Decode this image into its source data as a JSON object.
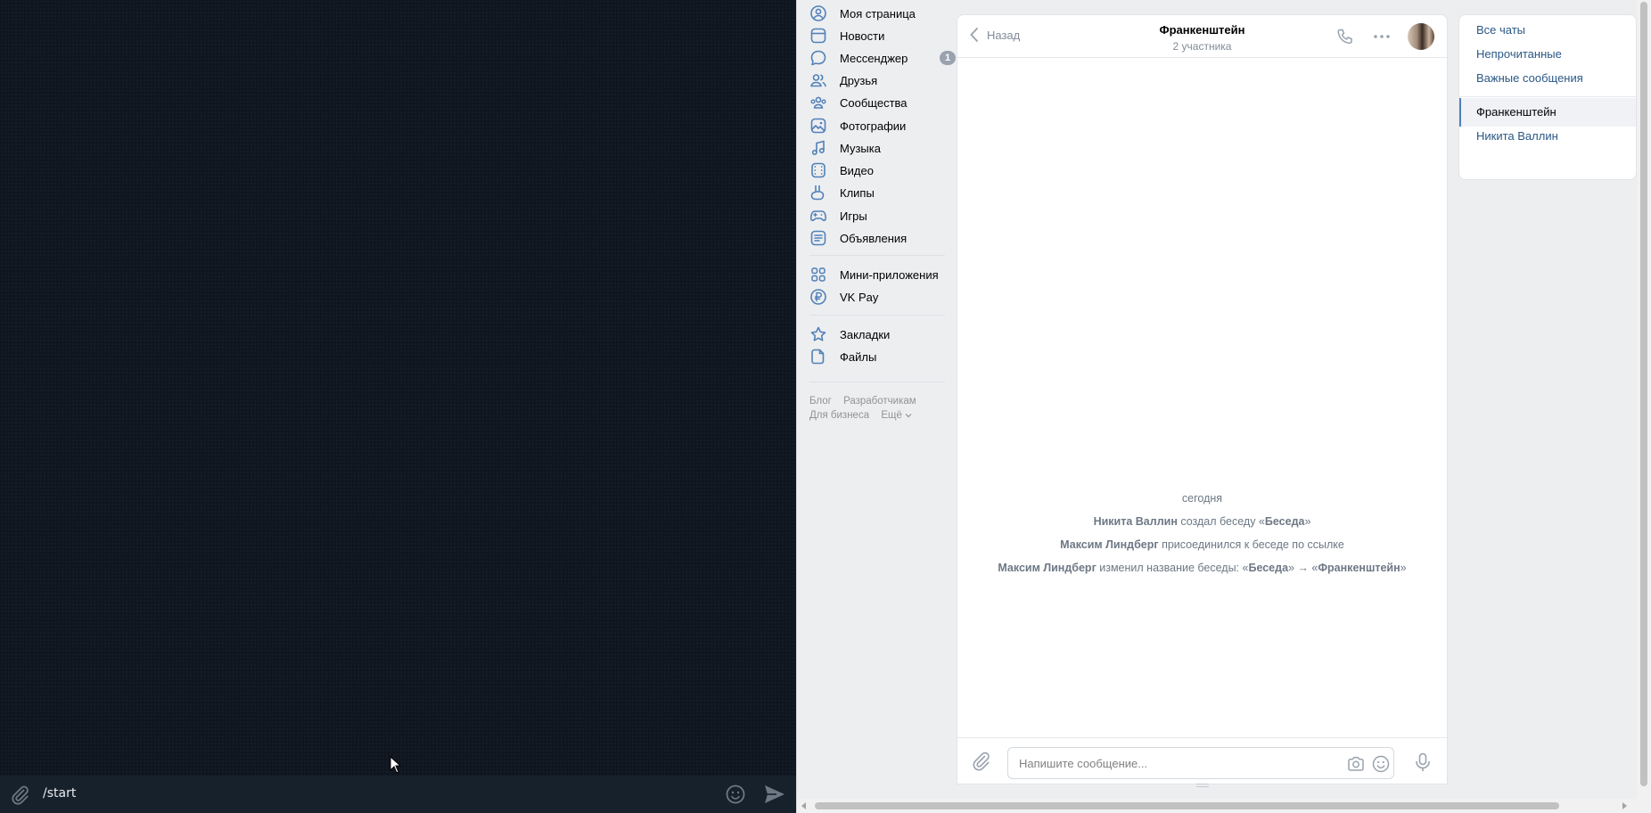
{
  "telegram": {
    "composer_text": "/start"
  },
  "vk_nav": {
    "items": [
      {
        "label": "Моя страница",
        "icon": "profile-icon"
      },
      {
        "label": "Новости",
        "icon": "news-icon"
      },
      {
        "label": "Мессенджер",
        "icon": "messenger-icon",
        "badge": "1"
      },
      {
        "label": "Друзья",
        "icon": "friends-icon"
      },
      {
        "label": "Сообщества",
        "icon": "communities-icon"
      },
      {
        "label": "Фотографии",
        "icon": "photos-icon"
      },
      {
        "label": "Музыка",
        "icon": "music-icon"
      },
      {
        "label": "Видео",
        "icon": "video-icon"
      },
      {
        "label": "Клипы",
        "icon": "clips-icon"
      },
      {
        "label": "Игры",
        "icon": "games-icon"
      },
      {
        "label": "Объявления",
        "icon": "ads-icon"
      },
      {
        "label": "Мини-приложения",
        "icon": "mini-apps-icon"
      },
      {
        "label": "VK Pay",
        "icon": "vk-pay-icon"
      },
      {
        "label": "Закладки",
        "icon": "bookmarks-icon"
      },
      {
        "label": "Файлы",
        "icon": "files-icon"
      }
    ],
    "footer": {
      "blog": "Блог",
      "developers": "Разработчикам",
      "business": "Для бизнеса",
      "more": "Ещё"
    }
  },
  "chat": {
    "back_label": "Назад",
    "title": "Франкенштейн",
    "subtitle": "2 участника",
    "date_divider": "сегодня",
    "events": {
      "created": {
        "actor": "Никита Валлин",
        "text": " создал беседу «",
        "name": "Беседа",
        "end": "»"
      },
      "joined": {
        "actor": "Максим Линдберг",
        "text": " присоединился к беседе по ссылке"
      },
      "renamed": {
        "actor": "Максим Линдберг",
        "text": " изменил название беседы: «",
        "old": "Беседа",
        "arrow": "» → «",
        "new": "Франкенштейн",
        "end": "»"
      }
    },
    "composer_placeholder": "Напишите сообщение..."
  },
  "filters": {
    "all": "Все чаты",
    "unread": "Непрочитанные",
    "important": "Важные сообщения",
    "chats": [
      "Франкенштейн",
      "Никита Валлин"
    ]
  },
  "colors": {
    "vk_link": "#2a5885",
    "vk_accent": "#5181b8",
    "dark_bg": "#0f1620"
  }
}
